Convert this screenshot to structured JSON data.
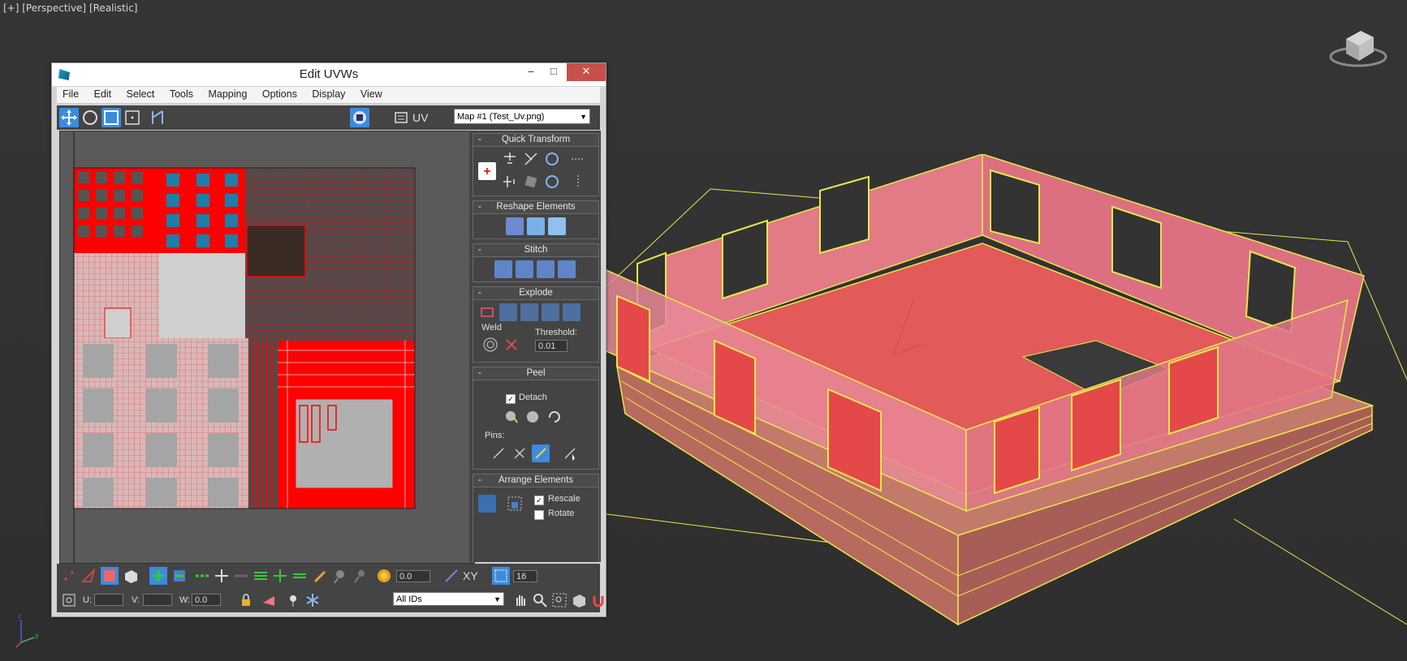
{
  "viewport": {
    "label_plus": "[+]",
    "label_view": "[Perspective]",
    "label_shading": "[Realistic]"
  },
  "window": {
    "title": "Edit UVWs",
    "btn_minimize": "–",
    "btn_maximize": "□",
    "btn_close": "✕"
  },
  "menu": [
    "File",
    "Edit",
    "Select",
    "Tools",
    "Mapping",
    "Options",
    "Display",
    "View"
  ],
  "toolbar": {
    "uv_label": "UV",
    "map_select": "Map #1 (Test_Uv.png)"
  },
  "rollouts": {
    "quick_transform": "Quick Transform",
    "reshape": "Reshape Elements",
    "stitch": "Stitch",
    "explode": "Explode",
    "weld": "Weld",
    "threshold_label": "Threshold:",
    "threshold_value": "0.01",
    "peel": "Peel",
    "detach": "Detach",
    "pins": "Pins:",
    "arrange": "Arrange Elements",
    "rescale": "Rescale",
    "rotate": "Rotate",
    "collapse": "-"
  },
  "bottom": {
    "spin_value": "0.0",
    "xy_label": "XY",
    "grid_value": "16",
    "u_label": "U:",
    "v_label": "V:",
    "w_label": "W:",
    "w_value": "0.0",
    "ids_select": "All IDs"
  },
  "colors": {
    "uv_red": "#ff0000",
    "highlight_blue": "#3c8be0",
    "wire_yellow": "#e8e84a",
    "house_pink": "#e06070"
  }
}
